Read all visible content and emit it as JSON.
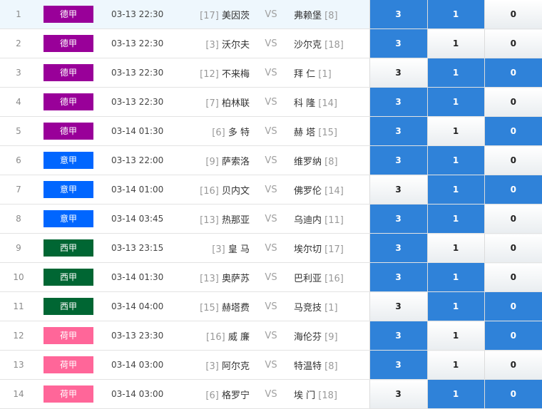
{
  "matches": [
    {
      "no": "1",
      "league": "德甲",
      "league_color": "#990099",
      "time": "03-13 22:30",
      "home_rank": "[17]",
      "home": "美因茨",
      "vs": "VS",
      "away": "弗赖堡",
      "away_rank": "[8]",
      "odds": [
        "3",
        "1",
        "0"
      ],
      "selected": [
        true,
        true,
        false
      ]
    },
    {
      "no": "2",
      "league": "德甲",
      "league_color": "#990099",
      "time": "03-13 22:30",
      "home_rank": "[3]",
      "home": "沃尔夫",
      "vs": "VS",
      "away": "沙尔克",
      "away_rank": "[18]",
      "odds": [
        "3",
        "1",
        "0"
      ],
      "selected": [
        true,
        false,
        false
      ]
    },
    {
      "no": "3",
      "league": "德甲",
      "league_color": "#990099",
      "time": "03-13 22:30",
      "home_rank": "[12]",
      "home": "不来梅",
      "vs": "VS",
      "away": "拜 仁",
      "away_rank": "[1]",
      "odds": [
        "3",
        "1",
        "0"
      ],
      "selected": [
        false,
        true,
        true
      ]
    },
    {
      "no": "4",
      "league": "德甲",
      "league_color": "#990099",
      "time": "03-13 22:30",
      "home_rank": "[7]",
      "home": "柏林联",
      "vs": "VS",
      "away": "科 隆",
      "away_rank": "[14]",
      "odds": [
        "3",
        "1",
        "0"
      ],
      "selected": [
        true,
        true,
        false
      ]
    },
    {
      "no": "5",
      "league": "德甲",
      "league_color": "#990099",
      "time": "03-14 01:30",
      "home_rank": "[6]",
      "home": "多 特",
      "vs": "VS",
      "away": "赫 塔",
      "away_rank": "[15]",
      "odds": [
        "3",
        "1",
        "0"
      ],
      "selected": [
        true,
        false,
        true
      ]
    },
    {
      "no": "6",
      "league": "意甲",
      "league_color": "#0066ff",
      "time": "03-13 22:00",
      "home_rank": "[9]",
      "home": "萨索洛",
      "vs": "VS",
      "away": "维罗纳",
      "away_rank": "[8]",
      "odds": [
        "3",
        "1",
        "0"
      ],
      "selected": [
        true,
        true,
        false
      ]
    },
    {
      "no": "7",
      "league": "意甲",
      "league_color": "#0066ff",
      "time": "03-14 01:00",
      "home_rank": "[16]",
      "home": "贝内文",
      "vs": "VS",
      "away": "佛罗伦",
      "away_rank": "[14]",
      "odds": [
        "3",
        "1",
        "0"
      ],
      "selected": [
        false,
        true,
        true
      ]
    },
    {
      "no": "8",
      "league": "意甲",
      "league_color": "#0066ff",
      "time": "03-14 03:45",
      "home_rank": "[13]",
      "home": "热那亚",
      "vs": "VS",
      "away": "乌迪内",
      "away_rank": "[11]",
      "odds": [
        "3",
        "1",
        "0"
      ],
      "selected": [
        true,
        true,
        false
      ]
    },
    {
      "no": "9",
      "league": "西甲",
      "league_color": "#006633",
      "time": "03-13 23:15",
      "home_rank": "[3]",
      "home": "皇 马",
      "vs": "VS",
      "away": "埃尔切",
      "away_rank": "[17]",
      "odds": [
        "3",
        "1",
        "0"
      ],
      "selected": [
        true,
        false,
        false
      ]
    },
    {
      "no": "10",
      "league": "西甲",
      "league_color": "#006633",
      "time": "03-14 01:30",
      "home_rank": "[13]",
      "home": "奥萨苏",
      "vs": "VS",
      "away": "巴利亚",
      "away_rank": "[16]",
      "odds": [
        "3",
        "1",
        "0"
      ],
      "selected": [
        true,
        true,
        false
      ]
    },
    {
      "no": "11",
      "league": "西甲",
      "league_color": "#006633",
      "time": "03-14 04:00",
      "home_rank": "[15]",
      "home": "赫塔费",
      "vs": "VS",
      "away": "马竞技",
      "away_rank": "[1]",
      "odds": [
        "3",
        "1",
        "0"
      ],
      "selected": [
        false,
        true,
        true
      ]
    },
    {
      "no": "12",
      "league": "荷甲",
      "league_color": "#ff6699",
      "time": "03-13 23:30",
      "home_rank": "[16]",
      "home": "威 廉",
      "vs": "VS",
      "away": "海伦芬",
      "away_rank": "[9]",
      "odds": [
        "3",
        "1",
        "0"
      ],
      "selected": [
        true,
        false,
        true
      ]
    },
    {
      "no": "13",
      "league": "荷甲",
      "league_color": "#ff6699",
      "time": "03-14 03:00",
      "home_rank": "[3]",
      "home": "阿尔克",
      "vs": "VS",
      "away": "特温特",
      "away_rank": "[8]",
      "odds": [
        "3",
        "1",
        "0"
      ],
      "selected": [
        true,
        false,
        false
      ]
    },
    {
      "no": "14",
      "league": "荷甲",
      "league_color": "#ff6699",
      "time": "03-14 03:00",
      "home_rank": "[6]",
      "home": "格罗宁",
      "vs": "VS",
      "away": "埃 门",
      "away_rank": "[18]",
      "odds": [
        "3",
        "1",
        "0"
      ],
      "selected": [
        false,
        true,
        true
      ]
    }
  ]
}
